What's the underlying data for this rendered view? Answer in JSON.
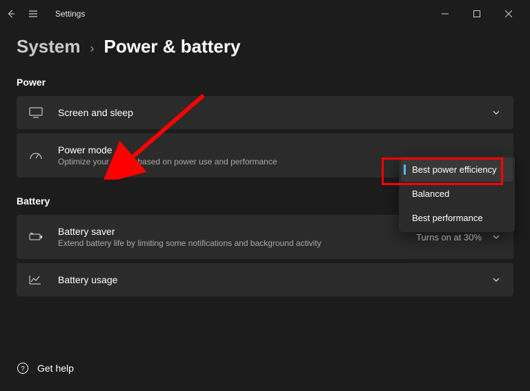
{
  "app": {
    "title": "Settings"
  },
  "breadcrumb": {
    "parent": "System",
    "current": "Power & battery"
  },
  "sections": {
    "power": {
      "label": "Power"
    },
    "battery": {
      "label": "Battery"
    }
  },
  "cards": {
    "screen_sleep": {
      "title": "Screen and sleep"
    },
    "power_mode": {
      "title": "Power mode",
      "sub": "Optimize your device based on power use and performance"
    },
    "battery_saver": {
      "title": "Battery saver",
      "sub": "Extend battery life by limiting some notifications and background activity",
      "status": "Turns on at 30%"
    },
    "battery_usage": {
      "title": "Battery usage"
    }
  },
  "dropdown": {
    "options": [
      {
        "label": "Best power efficiency",
        "selected": true
      },
      {
        "label": "Balanced",
        "selected": false
      },
      {
        "label": "Best performance",
        "selected": false
      }
    ]
  },
  "footer": {
    "get_help": "Get help"
  }
}
